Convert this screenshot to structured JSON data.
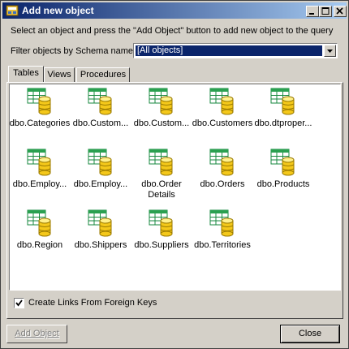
{
  "window": {
    "title": "Add new object"
  },
  "instructions": "Select an object and press the \"Add Object\" button to add new object to the query",
  "filter": {
    "label": "Filter objects by Schema name:",
    "selected": "[All objects]"
  },
  "tabs": [
    {
      "label": "Tables",
      "active": true
    },
    {
      "label": "Views",
      "active": false
    },
    {
      "label": "Procedures",
      "active": false
    }
  ],
  "tables": [
    {
      "name": "dbo.Categories"
    },
    {
      "name": "dbo.Custom..."
    },
    {
      "name": "dbo.Custom..."
    },
    {
      "name": "dbo.Customers"
    },
    {
      "name": "dbo.dtproper..."
    },
    {
      "name": "dbo.Employ..."
    },
    {
      "name": "dbo.Employ..."
    },
    {
      "name": "dbo.Order Details"
    },
    {
      "name": "dbo.Orders"
    },
    {
      "name": "dbo.Products"
    },
    {
      "name": "dbo.Region"
    },
    {
      "name": "dbo.Shippers"
    },
    {
      "name": "dbo.Suppliers"
    },
    {
      "name": "dbo.Territories"
    }
  ],
  "icons": {
    "item": "table-database-icon",
    "app": "app-icon"
  },
  "checkbox": {
    "label": "Create Links From Foreign Keys",
    "checked": true
  },
  "buttons": {
    "add": "Add Object",
    "close": "Close"
  },
  "colors": {
    "title_start": "#0a246a",
    "title_end": "#a6caf0",
    "selection": "#0a246a",
    "face": "#d4d0c8"
  }
}
